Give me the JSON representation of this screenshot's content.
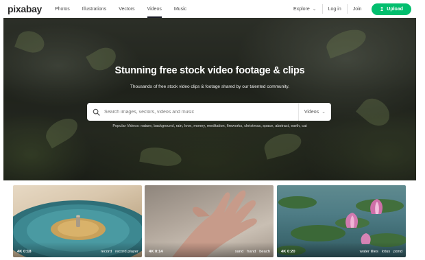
{
  "nav": {
    "logo": "pixabay",
    "links": [
      "Photos",
      "Illustrations",
      "Vectors",
      "Videos",
      "Music"
    ],
    "active": "Videos",
    "explore": "Explore",
    "login": "Log in",
    "join": "Join",
    "upload": "Upload",
    "accent": "#02be6e"
  },
  "hero": {
    "title": "Stunning free stock video footage & clips",
    "subtitle": "Thousands of free stock video clips & footage shared by our talented community.",
    "search_placeholder": "Search images, vectors, videos and music",
    "search_type": "Videos",
    "popular": "Popular Videos: nature, background, rain, love, money, meditation, fireworks, christmas, space, abstract, earth, cat"
  },
  "thumbs": [
    {
      "meta": "4K 0:18",
      "tags": [
        "record",
        "record player"
      ]
    },
    {
      "meta": "4K 0:14",
      "tags": [
        "sand",
        "hand",
        "beach"
      ]
    },
    {
      "meta": "4K 0:20",
      "tags": [
        "water lilies",
        "lotus",
        "pond"
      ]
    }
  ]
}
